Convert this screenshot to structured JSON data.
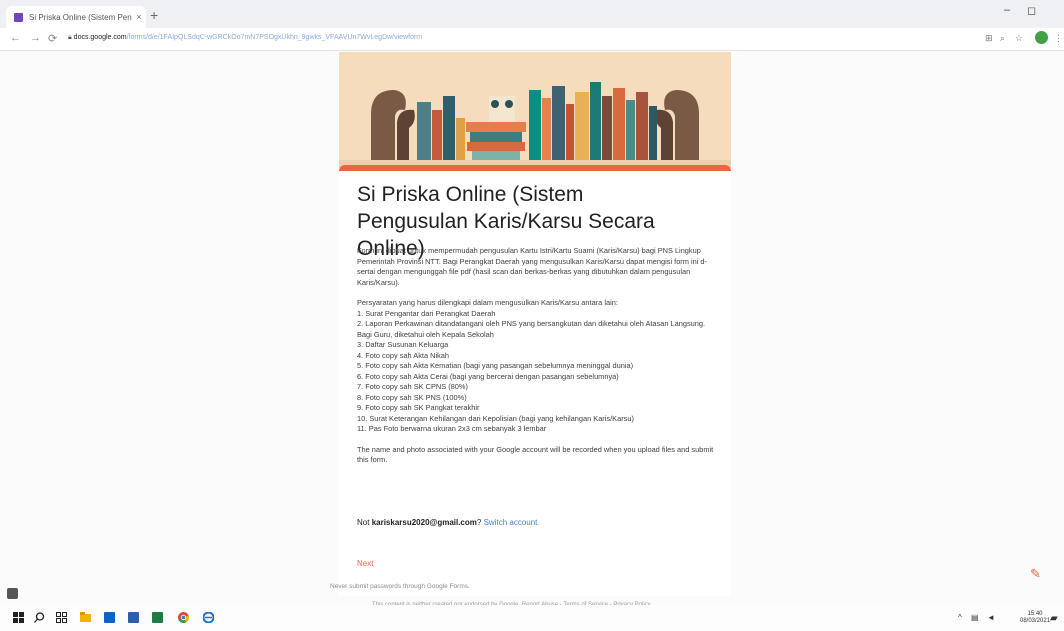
{
  "browser": {
    "tab_title": "Si Priska Online (Sistem Pengus",
    "tab_close": "×",
    "new_tab": "+",
    "url_domain": "docs.google.com",
    "url_path": "/forms/d/e/1FAIpQLSdqC-wGRCkOo7mN7PSOgxUkhn_9gwks_VFAAVUn7WvLegDw/viewform",
    "minimize": "–",
    "maximize": "◻",
    "profile_initial": ""
  },
  "form": {
    "title": "Si Priska Online (Sistem Pengusulan Karis/Karsu Secara Online)",
    "intro": "Form ini dibuat untuk mempermudah pengusulan Kartu Istri/Kartu Suami (Karis/Karsu) bagi PNS Lingkup Pemerintah Provinsi NTT. Bagi Perangkat Daerah yang mengusulkan Karis/Karsu dapat mengisi form ini d-sertai dengan mengunggah file pdf (hasil scan dari berkas-berkas yang dibutuhkan dalam pengusulan Karis/Karsu).",
    "requirements_heading": "Persyaratan yang harus dilengkapi dalam mengusulkan Karis/Karsu antara lain:",
    "requirements": [
      "1.   Surat Pengantar dari Perangkat Daerah",
      "2.   Laporan Perkawinan ditandatangani oleh PNS yang bersangkutan dan diketahui oleh Atasan Langsung. Bagi Guru, diketahui oleh Kepala Sekolah",
      "3.   Daftar Susunan Keluarga",
      "4.   Foto copy sah Akta Nikah",
      "5.   Foto copy sah Akta Kematian (bagi yang pasangan sebelumnya meninggal dunia)",
      "6.   Foto copy sah Akta Cerai (bagi yang bercerai dengan pasangan sebelumnya)",
      "7.   Foto copy sah SK CPNS (80%)",
      "8.   Foto copy sah SK PNS (100%)",
      "9.   Foto copy sah SK Pangkat terakhir",
      "10.  Surat Keterangan Kehilangan dari Kepolisian (bagi yang kehilangan Karis/Karsu)",
      "11.  Pas Foto berwarna ukuran 2x3 cm sebanyak 3 lembar"
    ],
    "privacy_note": "The name and photo associated with your Google account will be recorded when you upload files and submit this form.",
    "account_prefix": "Not",
    "account_email": "kariskarsu2020@gmail.com",
    "account_suffix": "?",
    "switch_account": "Switch account",
    "next_button": "Next",
    "no_password_note": "Never submit passwords through Google Forms.",
    "footer_note": "This content is neither created nor endorsed by Google. Report Abuse - Terms of Service - Privacy Policy"
  },
  "taskbar": {
    "time": "15:40",
    "date": "08/03/2021"
  },
  "colors": {
    "accent": "#e8663d",
    "link": "#4a7fd6"
  }
}
